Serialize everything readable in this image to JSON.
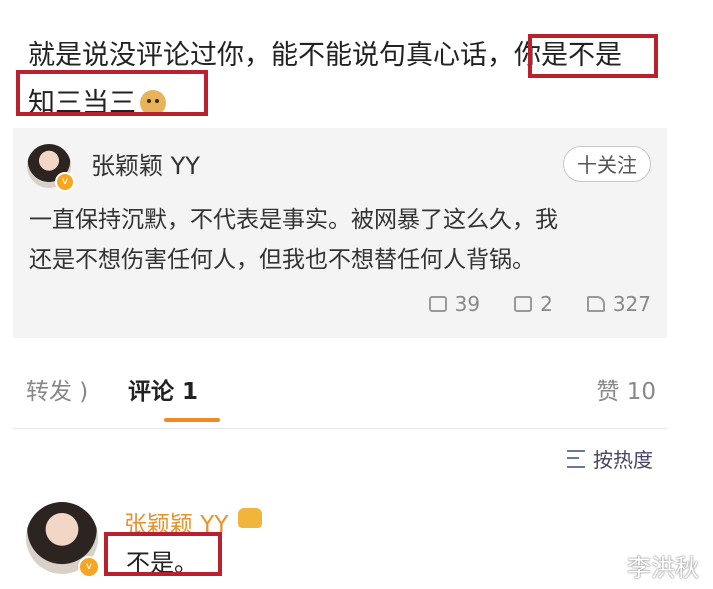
{
  "post": {
    "line1": "就是说没评论过你，能不能说句真心话，你是不是",
    "line2": "知三当三"
  },
  "card": {
    "author": "张颖颖 YY",
    "follow_label": "十关注",
    "body_line1": "一直保持沉默，不代表是事实。被网暴了这么久，我",
    "body_line2": "还是不想伤害任何人，但我也不想替任何人背锅。",
    "reposts": "39",
    "comments": "2",
    "likes": "327"
  },
  "tabs": {
    "repost": "转发 )",
    "comment": "评论 1",
    "like": "赞 10"
  },
  "sort_label": "按热度",
  "comment": {
    "author": "张颖颖 YY",
    "text": "不是。"
  },
  "watermark": "李洪秋",
  "colors": {
    "accent": "#f08a24",
    "highlight_box": "#b8212d",
    "name_orange": "#e8922a"
  }
}
